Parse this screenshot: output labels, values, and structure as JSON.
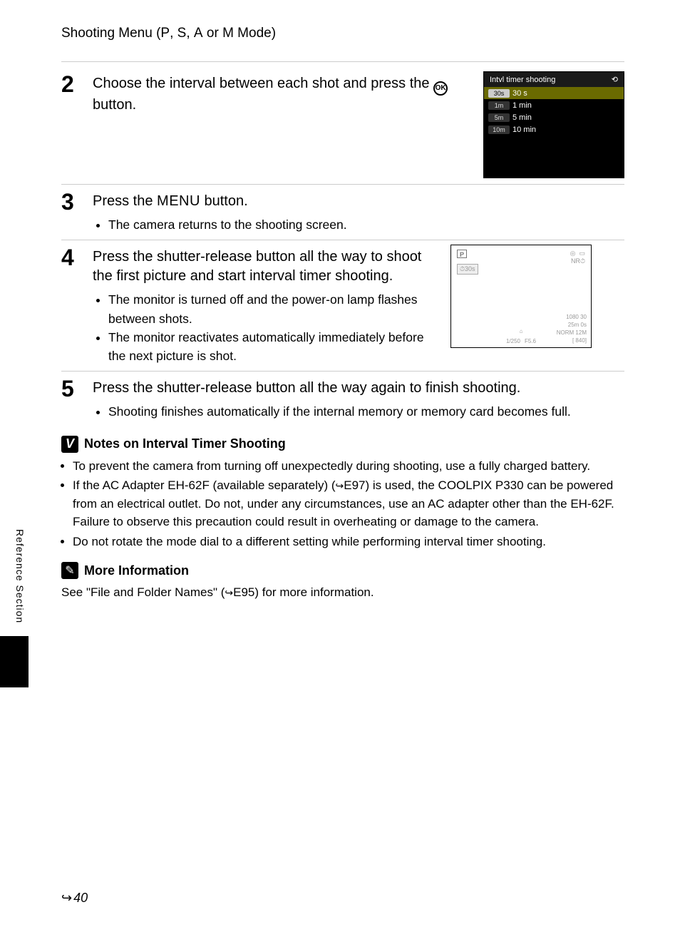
{
  "header": {
    "title_prefix": "Shooting Menu (",
    "mode_p": "P",
    "sep1": ", ",
    "mode_s": "S",
    "sep2": ", ",
    "mode_a": "A",
    "sep3": " or ",
    "mode_m": "M",
    "title_suffix": " Mode)"
  },
  "steps": {
    "s2": {
      "num": "2",
      "text_a": "Choose the interval between each shot and press the ",
      "ok": "k",
      "text_b": " button."
    },
    "s3": {
      "num": "3",
      "text_a": "Press the ",
      "menu": "MENU",
      "text_b": " button.",
      "b1": "The camera returns to the shooting screen."
    },
    "s4": {
      "num": "4",
      "text": "Press the shutter-release button all the way to shoot the first picture and start interval timer shooting.",
      "b1": "The monitor is turned off and the power-on lamp flashes between shots.",
      "b2": "The monitor reactivates automatically immediately before the next picture is shot."
    },
    "s5": {
      "num": "5",
      "text": "Press the shutter-release button all the way again to finish shooting.",
      "b1": "Shooting finishes automatically if the internal memory or memory card becomes full."
    }
  },
  "lcd_menu": {
    "title": "Intvl timer shooting",
    "rows": [
      {
        "icon": "30s",
        "label": "30 s"
      },
      {
        "icon": "1m",
        "label": "1 min"
      },
      {
        "icon": "5m",
        "label": "5 min"
      },
      {
        "icon": "10m",
        "label": "10 min"
      }
    ]
  },
  "lcd_shoot": {
    "mode": "P",
    "interval": "⏱30s",
    "nr": "NR⏱",
    "res": "1080 30",
    "time": "25m 0s",
    "norm": "NORM 12M",
    "shutter": "1/250",
    "fnum": "F5.6",
    "count": "[   840]"
  },
  "notes": {
    "n1": {
      "title": "Notes on Interval Timer Shooting",
      "b1": "To prevent the camera from turning off unexpectedly during shooting, use a fully charged battery.",
      "b2_a": "If the AC Adapter EH-62F (available separately) (",
      "b2_ref": "E97",
      "b2_b": ") is used, the COOLPIX P330 can be powered from an electrical outlet. Do not, under any circumstances, use an AC adapter other than the EH-62F. Failure to observe this precaution could result in overheating or damage to the camera.",
      "b3": "Do not rotate the mode dial to a different setting while performing interval timer shooting."
    },
    "n2": {
      "title": "More Information",
      "text_a": "See \"File and Folder Names\" (",
      "ref": "E95",
      "text_b": ") for more information."
    }
  },
  "side": "Reference Section",
  "footer": {
    "icon": "E",
    "page": "40"
  }
}
